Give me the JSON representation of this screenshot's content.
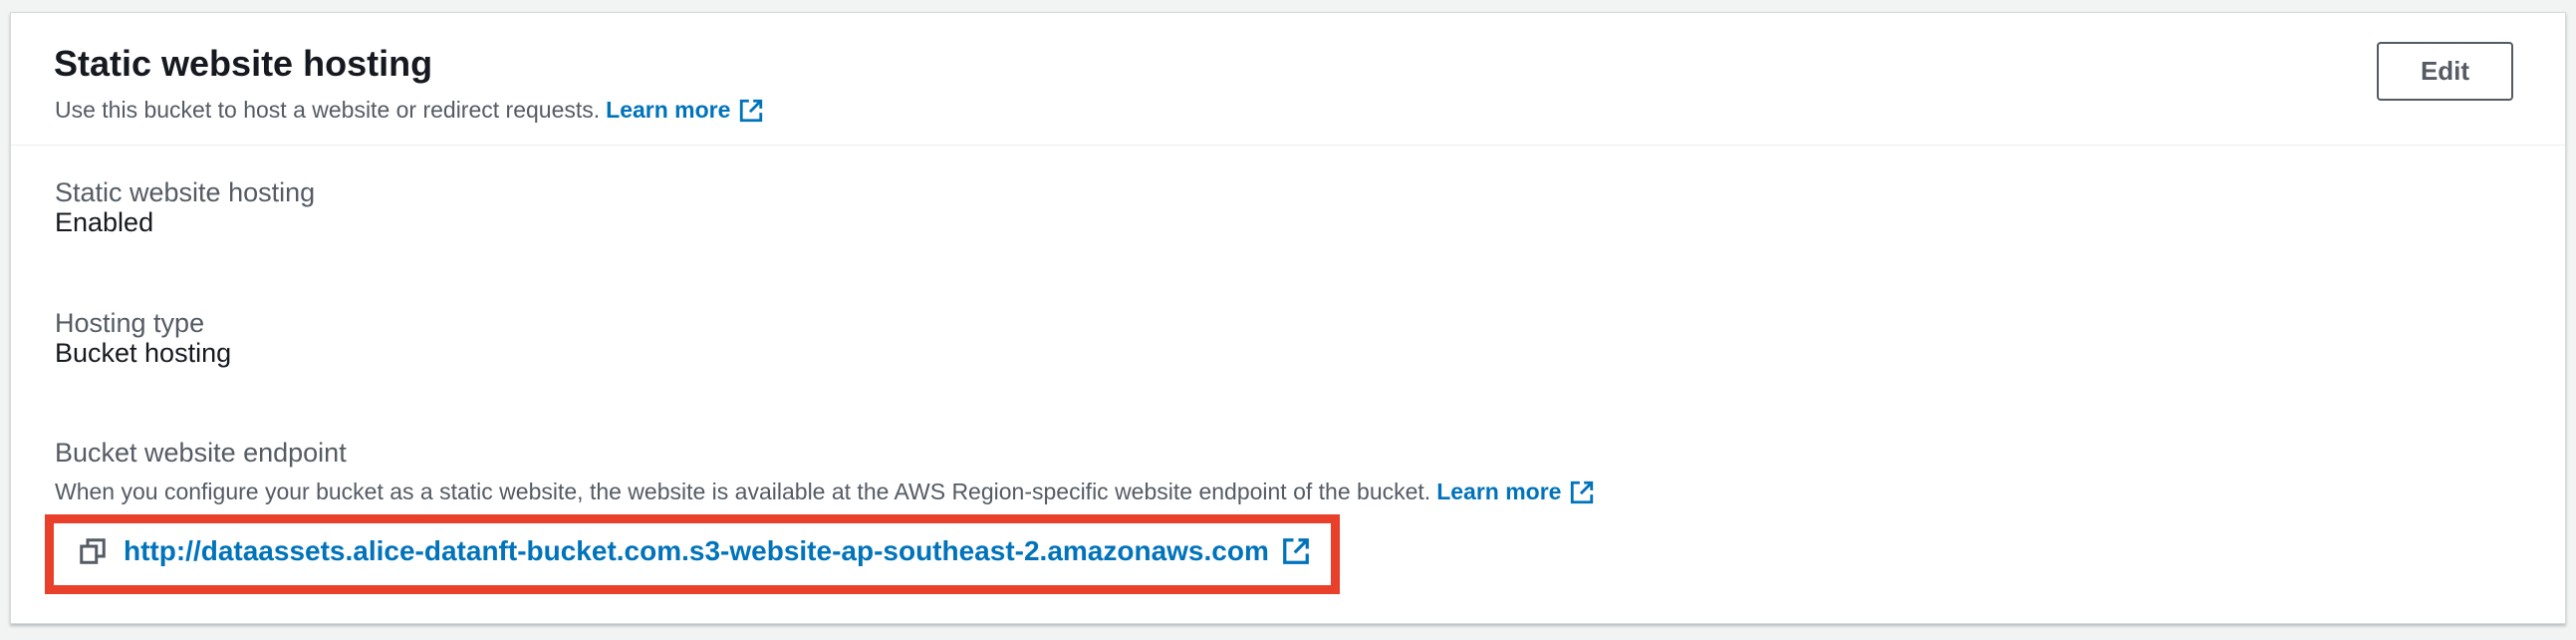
{
  "header": {
    "title": "Static website hosting",
    "description": "Use this bucket to host a website or redirect requests.",
    "learn_more": "Learn more",
    "edit_label": "Edit"
  },
  "fields": {
    "hosting": {
      "label": "Static website hosting",
      "value": "Enabled"
    },
    "hosting_type": {
      "label": "Hosting type",
      "value": "Bucket hosting"
    },
    "endpoint": {
      "label": "Bucket website endpoint",
      "description": "When you configure your bucket as a static website, the website is available at the AWS Region-specific website endpoint of the bucket.",
      "learn_more": "Learn more",
      "url": "http://dataassets.alice-datanft-bucket.com.s3-website-ap-southeast-2.amazonaws.com"
    }
  },
  "icons": {
    "external": "external-link-icon",
    "copy": "copy-icon"
  },
  "colors": {
    "link": "#0073bb",
    "highlight": "#e8402b",
    "muted_text": "#545b64"
  }
}
